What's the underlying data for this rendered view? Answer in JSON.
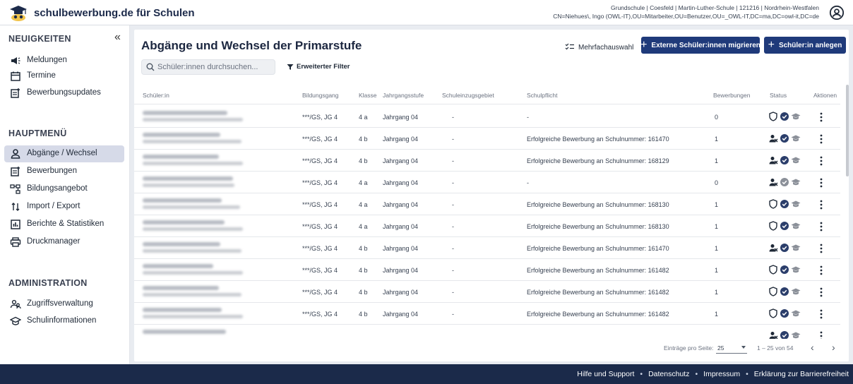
{
  "header": {
    "brand": "schulbewerbung.de für Schulen",
    "user_line1": "Grundschule | Coesfeld | Martin-Luther-Schule | 121216 | Nordrhein-Westfalen",
    "user_line2": "CN=Niehues\\, Ingo (OWL-IT),OU=Mitarbeiter,OU=Benutzer,OU=_OWL-IT,DC=ma,DC=owl-it,DC=de",
    "user_icon": "account-circle-icon"
  },
  "sidebar": {
    "sections": [
      {
        "title": "NEUIGKEITEN",
        "items": [
          {
            "label": "Meldungen",
            "icon": "megaphone-icon"
          },
          {
            "label": "Termine",
            "icon": "calendar-icon"
          },
          {
            "label": "Bewerbungsupdates",
            "icon": "update-icon"
          }
        ]
      },
      {
        "title": "HAUPTMENÜ",
        "items": [
          {
            "label": "Abgänge / Wechsel",
            "icon": "person-icon",
            "active": true
          },
          {
            "label": "Bewerbungen",
            "icon": "document-plus-icon"
          },
          {
            "label": "Bildungsangebot",
            "icon": "structure-icon"
          },
          {
            "label": "Import / Export",
            "icon": "import-export-icon"
          },
          {
            "label": "Berichte & Statistiken",
            "icon": "chart-icon"
          },
          {
            "label": "Druckmanager",
            "icon": "printer-icon"
          }
        ]
      },
      {
        "title": "ADMINISTRATION",
        "items": [
          {
            "label": "Zugriffsverwaltung",
            "icon": "users-icon"
          },
          {
            "label": "Schulinformationen",
            "icon": "school-icon"
          }
        ]
      }
    ],
    "collapse_symbol": "«"
  },
  "main": {
    "title": "Abgänge und Wechsel der Primarstufe",
    "multi_select_label": "Mehrfachauswahl",
    "btn_migrate_label": "Externe Schüler:innen migrieren",
    "btn_create_label": "Schüler:in anlegen",
    "search_placeholder": "Schüler:innen durchsuchen...",
    "filter_label": "Erweiterter Filter",
    "columns": [
      "Schüler:in",
      "Bildungsgang",
      "Klasse",
      "Jahrgangsstufe",
      "Schuleinzugsgebiet",
      "Schulpflicht",
      "Bewerbungen",
      "Status",
      "Aktionen"
    ],
    "rows": [
      {
        "bildungsgang": "***/GS, JG 4",
        "klasse": "4 a",
        "jahrgang": "Jahrgang 04",
        "einzug": "-",
        "pflicht": "-",
        "bewerbungen": "0",
        "status": "shield"
      },
      {
        "bildungsgang": "***/GS, JG 4",
        "klasse": "4 b",
        "jahrgang": "Jahrgang 04",
        "einzug": "-",
        "pflicht": "Erfolgreiche Bewerbung an Schulnummer: 161470",
        "bewerbungen": "1",
        "status": "person"
      },
      {
        "bildungsgang": "***/GS, JG 4",
        "klasse": "4 b",
        "jahrgang": "Jahrgang 04",
        "einzug": "-",
        "pflicht": "Erfolgreiche Bewerbung an Schulnummer: 168129",
        "bewerbungen": "1",
        "status": "person"
      },
      {
        "bildungsgang": "***/GS, JG 4",
        "klasse": "4 a",
        "jahrgang": "Jahrgang 04",
        "einzug": "-",
        "pflicht": "-",
        "bewerbungen": "0",
        "status": "person-grey"
      },
      {
        "bildungsgang": "***/GS, JG 4",
        "klasse": "4 a",
        "jahrgang": "Jahrgang 04",
        "einzug": "-",
        "pflicht": "Erfolgreiche Bewerbung an Schulnummer: 168130",
        "bewerbungen": "1",
        "status": "shield"
      },
      {
        "bildungsgang": "***/GS, JG 4",
        "klasse": "4 a",
        "jahrgang": "Jahrgang 04",
        "einzug": "-",
        "pflicht": "Erfolgreiche Bewerbung an Schulnummer: 168130",
        "bewerbungen": "1",
        "status": "shield"
      },
      {
        "bildungsgang": "***/GS, JG 4",
        "klasse": "4 b",
        "jahrgang": "Jahrgang 04",
        "einzug": "-",
        "pflicht": "Erfolgreiche Bewerbung an Schulnummer: 161470",
        "bewerbungen": "1",
        "status": "person"
      },
      {
        "bildungsgang": "***/GS, JG 4",
        "klasse": "4 b",
        "jahrgang": "Jahrgang 04",
        "einzug": "-",
        "pflicht": "Erfolgreiche Bewerbung an Schulnummer: 161482",
        "bewerbungen": "1",
        "status": "shield"
      },
      {
        "bildungsgang": "***/GS, JG 4",
        "klasse": "4 b",
        "jahrgang": "Jahrgang 04",
        "einzug": "-",
        "pflicht": "Erfolgreiche Bewerbung an Schulnummer: 161482",
        "bewerbungen": "1",
        "status": "shield"
      },
      {
        "bildungsgang": "***/GS, JG 4",
        "klasse": "4 b",
        "jahrgang": "Jahrgang 04",
        "einzug": "-",
        "pflicht": "Erfolgreiche Bewerbung an Schulnummer: 161482",
        "bewerbungen": "1",
        "status": "shield"
      },
      {
        "bildungsgang": "",
        "klasse": "",
        "jahrgang": "",
        "einzug": "",
        "pflicht": "",
        "bewerbungen": "",
        "status": "person"
      }
    ],
    "pagination": {
      "per_page_label": "Einträge pro Seite:",
      "per_page_value": "25",
      "range_label": "1 – 25 von 54",
      "prev": "‹",
      "next": "›"
    }
  },
  "footer": {
    "links": [
      "Hilfe und Support",
      "Datenschutz",
      "Impressum",
      "Erklärung zur Barrierefreiheit"
    ],
    "separator": "•"
  },
  "colors": {
    "primary": "#1f3a7a",
    "footer_bg": "#1b2a4a",
    "active_nav": "#d6dae8"
  }
}
